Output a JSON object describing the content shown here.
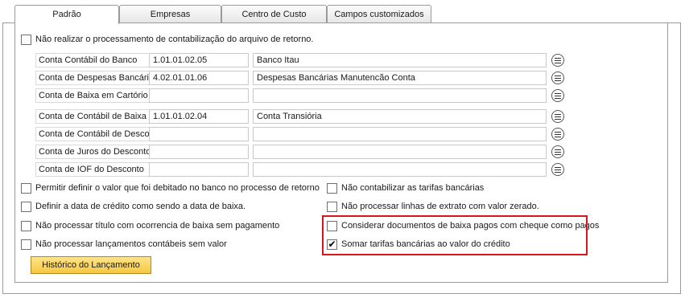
{
  "tabs": [
    {
      "label": "Padrão",
      "active": true
    },
    {
      "label": "Empresas",
      "active": false
    },
    {
      "label": "Centro de Custo",
      "active": false
    },
    {
      "label": "Campos customizados",
      "active": false
    }
  ],
  "top_option": {
    "label": "Não realizar o processamento de contabilização do arquivo de retorno.",
    "checked": false
  },
  "accounts": [
    {
      "label": "Conta Contábil do Banco",
      "code": "1.01.01.02.05",
      "description": "Banco Itau"
    },
    {
      "label": "Conta de Despesas Bancárias",
      "code": "4.02.01.01.06",
      "description": "Despesas Bancárias Manutencão Conta"
    },
    {
      "label": "Conta de Baixa em Cartório",
      "code": "",
      "description": ""
    },
    {
      "label": "Conta de Contábil de Baixa",
      "code": "1.01.01.02.04",
      "description": "Conta Transiória"
    },
    {
      "label": "Conta de Contábil de Desconto",
      "code": "",
      "description": ""
    },
    {
      "label": "Conta de Juros do Desconto",
      "code": "",
      "description": ""
    },
    {
      "label": "Conta de IOF do Desconto",
      "code": "",
      "description": ""
    }
  ],
  "left_options": [
    {
      "label": "Permitir definir o valor que foi debitado no banco no processo de retorno",
      "checked": false
    },
    {
      "label": "Definir a data de crédito como sendo a data de baixa.",
      "checked": false
    },
    {
      "label": "Não processar título com ocorrencia de baixa sem pagamento",
      "checked": false
    },
    {
      "label": "Não processar lançamentos contábeis sem valor",
      "checked": false
    }
  ],
  "right_options": [
    {
      "label": "Não contabilizar as tarifas bancárias",
      "checked": false
    },
    {
      "label": "Não processar linhas de extrato com valor zerado.",
      "checked": false
    },
    {
      "label": "Considerar documentos de baixa pagos com cheque como pagos",
      "checked": false
    },
    {
      "label": "Somar tarifas bancárias ao valor do crédito",
      "checked": true
    }
  ],
  "button": {
    "label": "Histórico do Lançamento"
  },
  "checkmark": "✔"
}
